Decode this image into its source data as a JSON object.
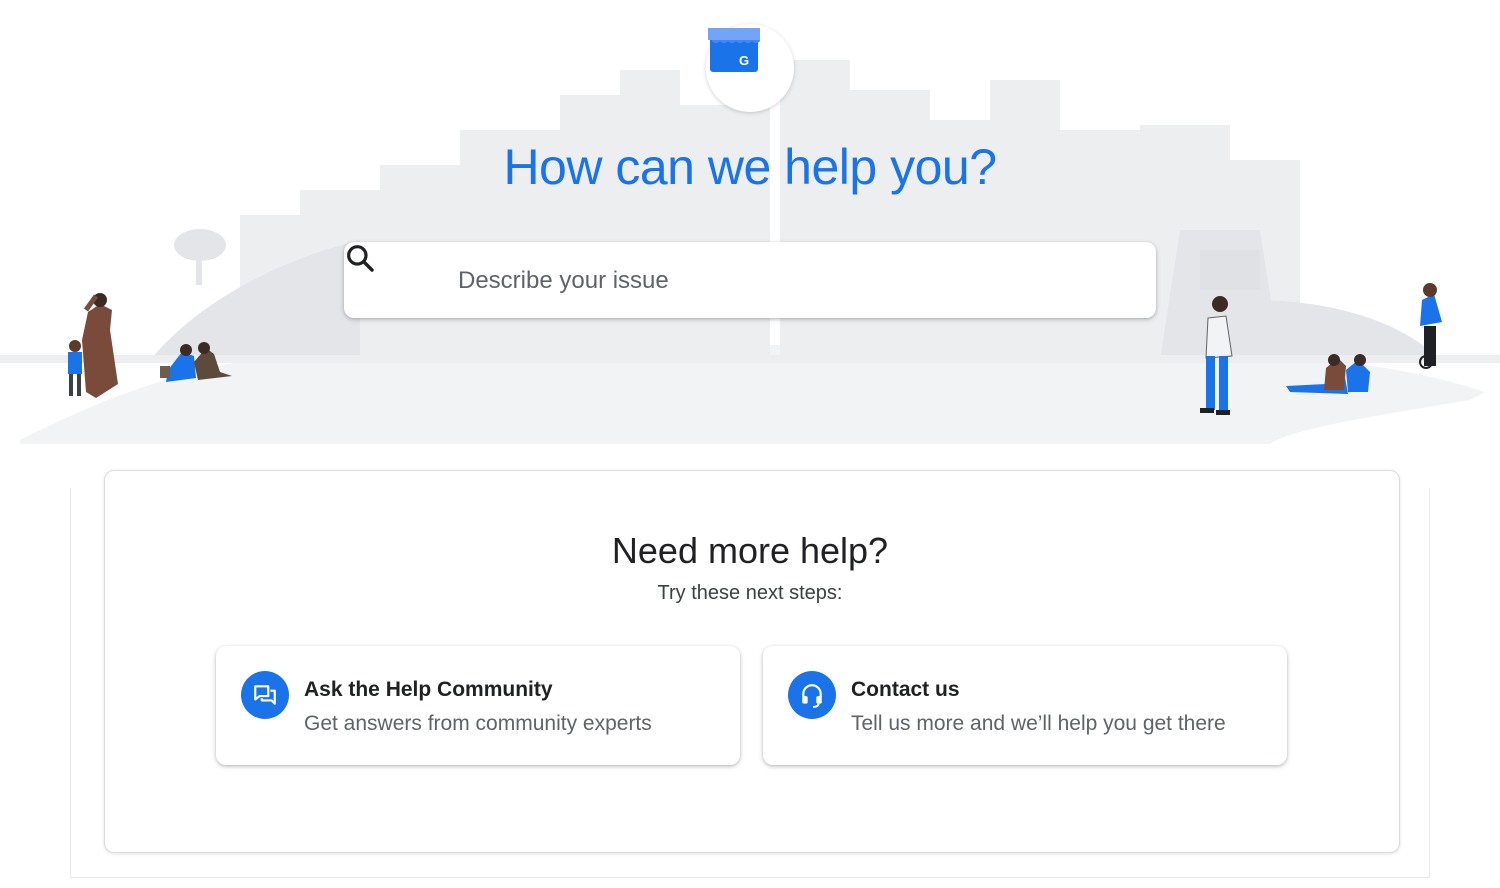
{
  "hero": {
    "title": "How can we help you?",
    "logo_icon": "google-my-business-storefront-icon",
    "brand_color": "#1a73e8"
  },
  "search": {
    "placeholder": "Describe your issue",
    "icon": "search-icon"
  },
  "help": {
    "title": "Need more help?",
    "subtitle": "Try these next steps:",
    "options": [
      {
        "icon": "chat-bubbles-icon",
        "title": "Ask the Help Community",
        "description": "Get answers from community experts"
      },
      {
        "icon": "headset-icon",
        "title": "Contact us",
        "description": "Tell us more and we’ll help you get there"
      }
    ]
  }
}
